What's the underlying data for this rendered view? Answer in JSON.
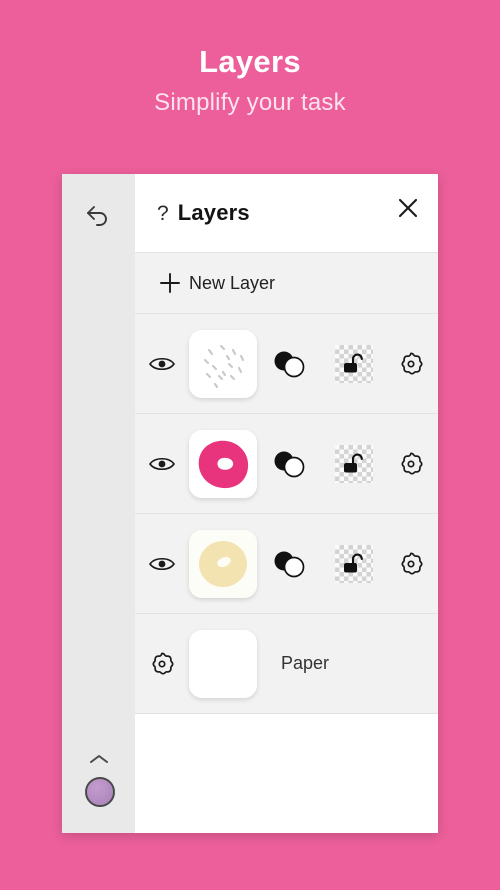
{
  "promo": {
    "title": "Layers",
    "subtitle": "Simplify your task",
    "background_color": "#ec5f9a",
    "title_color": "#ffffff",
    "subtitle_color": "#fde3ed"
  },
  "app": {
    "rail": {
      "undo_icon": "undo-arrow-icon",
      "chevron_icon": "chevron-up-icon",
      "color_swatch": {
        "name": "color-swatch",
        "color": "#b28cc0"
      }
    },
    "canvas": {
      "artwork": "pink-donut-with-sprinkles",
      "donut_color": "#e8699f",
      "donut_shadow_color": "#d9538f",
      "sprinkle_colors": [
        "#f7b8cd",
        "#fbd0de",
        "#8f2a44"
      ],
      "background": "#ffffff"
    },
    "panel": {
      "header": {
        "help_icon": "?",
        "title": "Layers",
        "close_icon": "close-icon"
      },
      "new_layer": {
        "icon": "plus-icon",
        "label": "New Layer"
      },
      "columns": [
        "visibility",
        "thumbnail",
        "blend-mode",
        "lock",
        "settings"
      ],
      "layers": [
        {
          "index": 0,
          "name": "sprinkles-layer",
          "visible": true,
          "visibility_icon": "eye-icon",
          "thumbnail": "sprinkles-thumbnail",
          "thumbnail_bg": "#ffffff",
          "blend_icon": "blend-mode-icon",
          "lock_icon": "unlocked-padlock-icon",
          "locked": false,
          "lock_background": "checkerboard",
          "settings_icon": "gear-icon"
        },
        {
          "index": 1,
          "name": "icing-layer",
          "visible": true,
          "visibility_icon": "eye-icon",
          "thumbnail": "pink-donut-thumbnail",
          "thumbnail_bg": "#ffffff",
          "blend_icon": "blend-mode-icon",
          "lock_icon": "unlocked-padlock-icon",
          "locked": false,
          "lock_background": "checkerboard",
          "settings_icon": "gear-icon"
        },
        {
          "index": 2,
          "name": "dough-layer",
          "visible": true,
          "visibility_icon": "eye-icon",
          "thumbnail": "cream-donut-thumbnail",
          "thumbnail_bg": "#ffffff",
          "blend_icon": "blend-mode-icon",
          "lock_icon": "unlocked-padlock-icon",
          "locked": false,
          "lock_background": "checkerboard",
          "settings_icon": "gear-icon"
        }
      ],
      "paper_row": {
        "settings_icon": "gear-icon",
        "thumbnail": "blank-white-thumbnail",
        "label": "Paper"
      }
    }
  },
  "colors": {
    "panel_bg": "#ffffff",
    "row_bg": "#f2f2f2",
    "rail_bg": "#e9e9e9",
    "divider": "#e2e2e2",
    "icon": "#1a1a1a",
    "thumb_pink": "#e8337d",
    "thumb_cream": "#f2e3b0"
  }
}
